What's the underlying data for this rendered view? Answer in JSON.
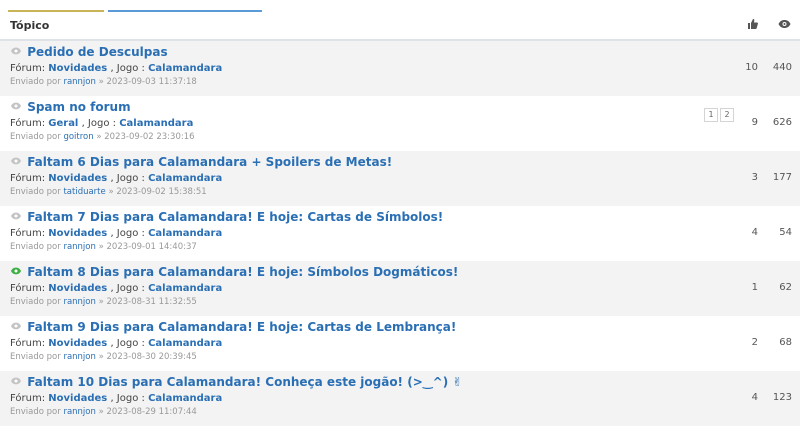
{
  "header": {
    "title": "Tópico",
    "likes_icon": "thumbs-up-icon",
    "views_icon": "eye-icon"
  },
  "labels": {
    "forum_prefix": "Fórum:",
    "game_prefix": ", Jogo :",
    "sent_by": "Enviado por",
    "sep": "»"
  },
  "topics": [
    {
      "title": "Pedido de Desculpas",
      "forum": "Novidades",
      "game": "Calamandara",
      "author": "rannjon",
      "date": "2023-09-03 11:37:18",
      "likes": "10",
      "views": "440",
      "new": false
    },
    {
      "title": "Spam no forum",
      "forum": "Geral",
      "game": "Calamandara",
      "author": "goitron",
      "date": "2023-09-02 23:30:16",
      "likes": "9",
      "views": "626",
      "new": false,
      "pages": [
        "1",
        "2"
      ]
    },
    {
      "title": "Faltam 6 Dias para Calamandara + Spoilers de Metas!",
      "forum": "Novidades",
      "game": "Calamandara",
      "author": "tatiduarte",
      "date": "2023-09-02 15:38:51",
      "likes": "3",
      "views": "177",
      "new": false
    },
    {
      "title": "Faltam 7 Dias para Calamandara! E hoje: Cartas de Símbolos!",
      "forum": "Novidades",
      "game": "Calamandara",
      "author": "rannjon",
      "date": "2023-09-01 14:40:37",
      "likes": "4",
      "views": "54",
      "new": false
    },
    {
      "title": "Faltam 8 Dias para Calamandara! E hoje: Símbolos Dogmáticos!",
      "forum": "Novidades",
      "game": "Calamandara",
      "author": "rannjon",
      "date": "2023-08-31 11:32:55",
      "likes": "1",
      "views": "62",
      "new": true
    },
    {
      "title": "Faltam 9 Dias para Calamandara! E hoje: Cartas de Lembrança!",
      "forum": "Novidades",
      "game": "Calamandara",
      "author": "rannjon",
      "date": "2023-08-30 20:39:45",
      "likes": "2",
      "views": "68",
      "new": false
    },
    {
      "title": "Faltam 10 Dias para Calamandara! Conheça este jogão! (>‿^) ✌",
      "forum": "Novidades",
      "game": "Calamandara",
      "author": "rannjon",
      "date": "2023-08-29 11:07:44",
      "likes": "4",
      "views": "123",
      "new": false
    }
  ],
  "colors": {
    "link": "#2a6fb4",
    "new_eye": "#3cb043",
    "row_alt": "#f3f3f3"
  }
}
